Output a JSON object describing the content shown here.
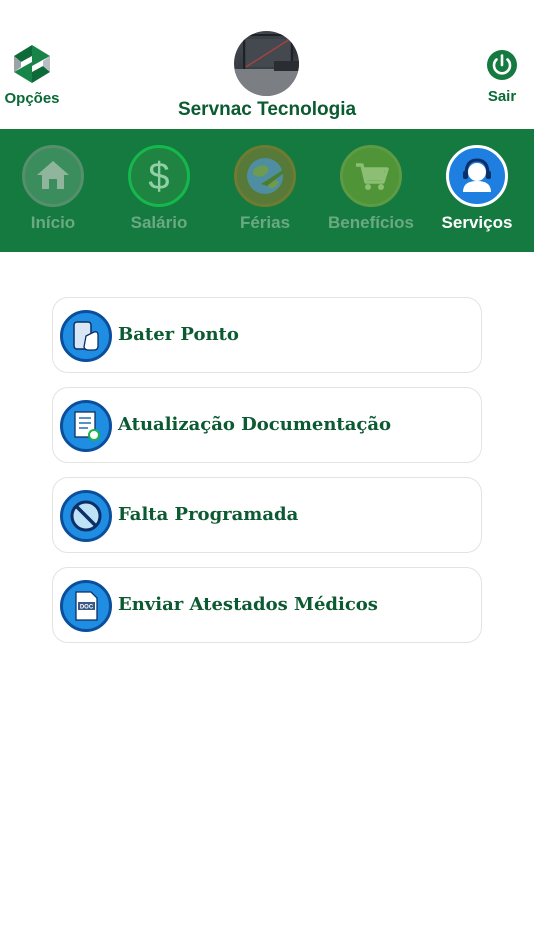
{
  "header": {
    "options_label": "Opções",
    "company_name": "Servnac Tecnologia",
    "logout_label": "Sair"
  },
  "tabs": [
    {
      "label": "Início",
      "icon": "home-icon",
      "active": false
    },
    {
      "label": "Salário",
      "icon": "dollar-icon",
      "active": false
    },
    {
      "label": "Férias",
      "icon": "globe-plane-icon",
      "active": false
    },
    {
      "label": "Benefícios",
      "icon": "cart-icon",
      "active": false
    },
    {
      "label": "Serviços",
      "icon": "support-agent-icon",
      "active": true
    }
  ],
  "services": [
    {
      "label": "Bater Ponto",
      "icon": "phone-touch-icon"
    },
    {
      "label": "Atualização Documentação",
      "icon": "document-update-icon"
    },
    {
      "label": "Falta Programada",
      "icon": "prohibited-icon"
    },
    {
      "label": "Enviar Atestados Médicos",
      "icon": "doc-file-icon"
    }
  ],
  "colors": {
    "brand_green": "#157a40",
    "text_green": "#0a5b30",
    "icon_blue": "#1f8ee2"
  }
}
